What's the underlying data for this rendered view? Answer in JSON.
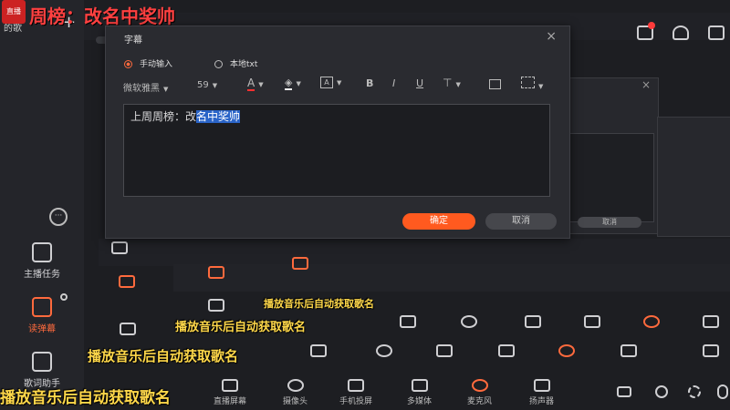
{
  "overlay_title": "周榜：改名中奖帅",
  "logo_text": "直播",
  "sidebar": {
    "top_label": "的歌",
    "add_symbol": "+",
    "more_symbol": "···",
    "items": [
      {
        "label": "主播任务",
        "icon": "task-icon"
      },
      {
        "label": "读弹幕",
        "icon": "danmaku-icon"
      },
      {
        "label": "歌词助手",
        "icon": "lyrics-icon"
      }
    ]
  },
  "dialog": {
    "title": "字幕",
    "close": "×",
    "modes": [
      {
        "label": "手动输入",
        "selected": true
      },
      {
        "label": "本地txt",
        "selected": false
      }
    ],
    "toolbar": {
      "font": "微软雅黑",
      "size": "59",
      "bold": "B",
      "italic": "I",
      "underline": "U"
    },
    "text_before": "上周周榜：改",
    "text_selected": "名中奖帅",
    "ok_label": "确定",
    "cancel_label": "取消"
  },
  "ghost_dialog": {
    "cancel_label": "取消"
  },
  "captions": [
    "播放音乐后自动获取歌名",
    "播放音乐后自动获取歌名",
    "播放音乐后自动获取歌名",
    "播放音乐后自动获取歌名"
  ],
  "bottom_bar": {
    "items": [
      "直播屏幕",
      "摄像头",
      "手机投屏",
      "多媒体",
      "麦克风",
      "扬声器"
    ]
  },
  "colors": {
    "accent": "#ff5a1f",
    "caption": "#ffd84a",
    "title_red": "#ff4040",
    "selection": "#2a64c8"
  }
}
